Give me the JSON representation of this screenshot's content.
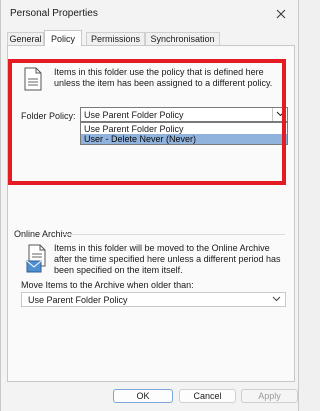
{
  "window": {
    "title": "Personal Properties"
  },
  "tabs": [
    {
      "label": "General"
    },
    {
      "label": "Policy"
    },
    {
      "label": "Permissions"
    },
    {
      "label": "Synchronisation"
    }
  ],
  "policy": {
    "description": "Items in this folder use the policy that is defined here unless the item has been assigned to a different policy.",
    "folder_policy_label": "Folder Policy:",
    "selected": "Use Parent Folder Policy",
    "options": [
      "Use Parent Folder Policy",
      "User - Delete Never (Never)"
    ],
    "highlight_color": "#e41b23"
  },
  "archive": {
    "section_label": "Online Archive",
    "description": "Items in this folder will be moved to the Online Archive after the time specified here unless a different period has been specified on the item itself.",
    "move_label": "Move Items to the Archive when older than:",
    "selected": "Use Parent Folder Policy"
  },
  "buttons": {
    "ok": "OK",
    "cancel": "Cancel",
    "apply": "Apply"
  }
}
